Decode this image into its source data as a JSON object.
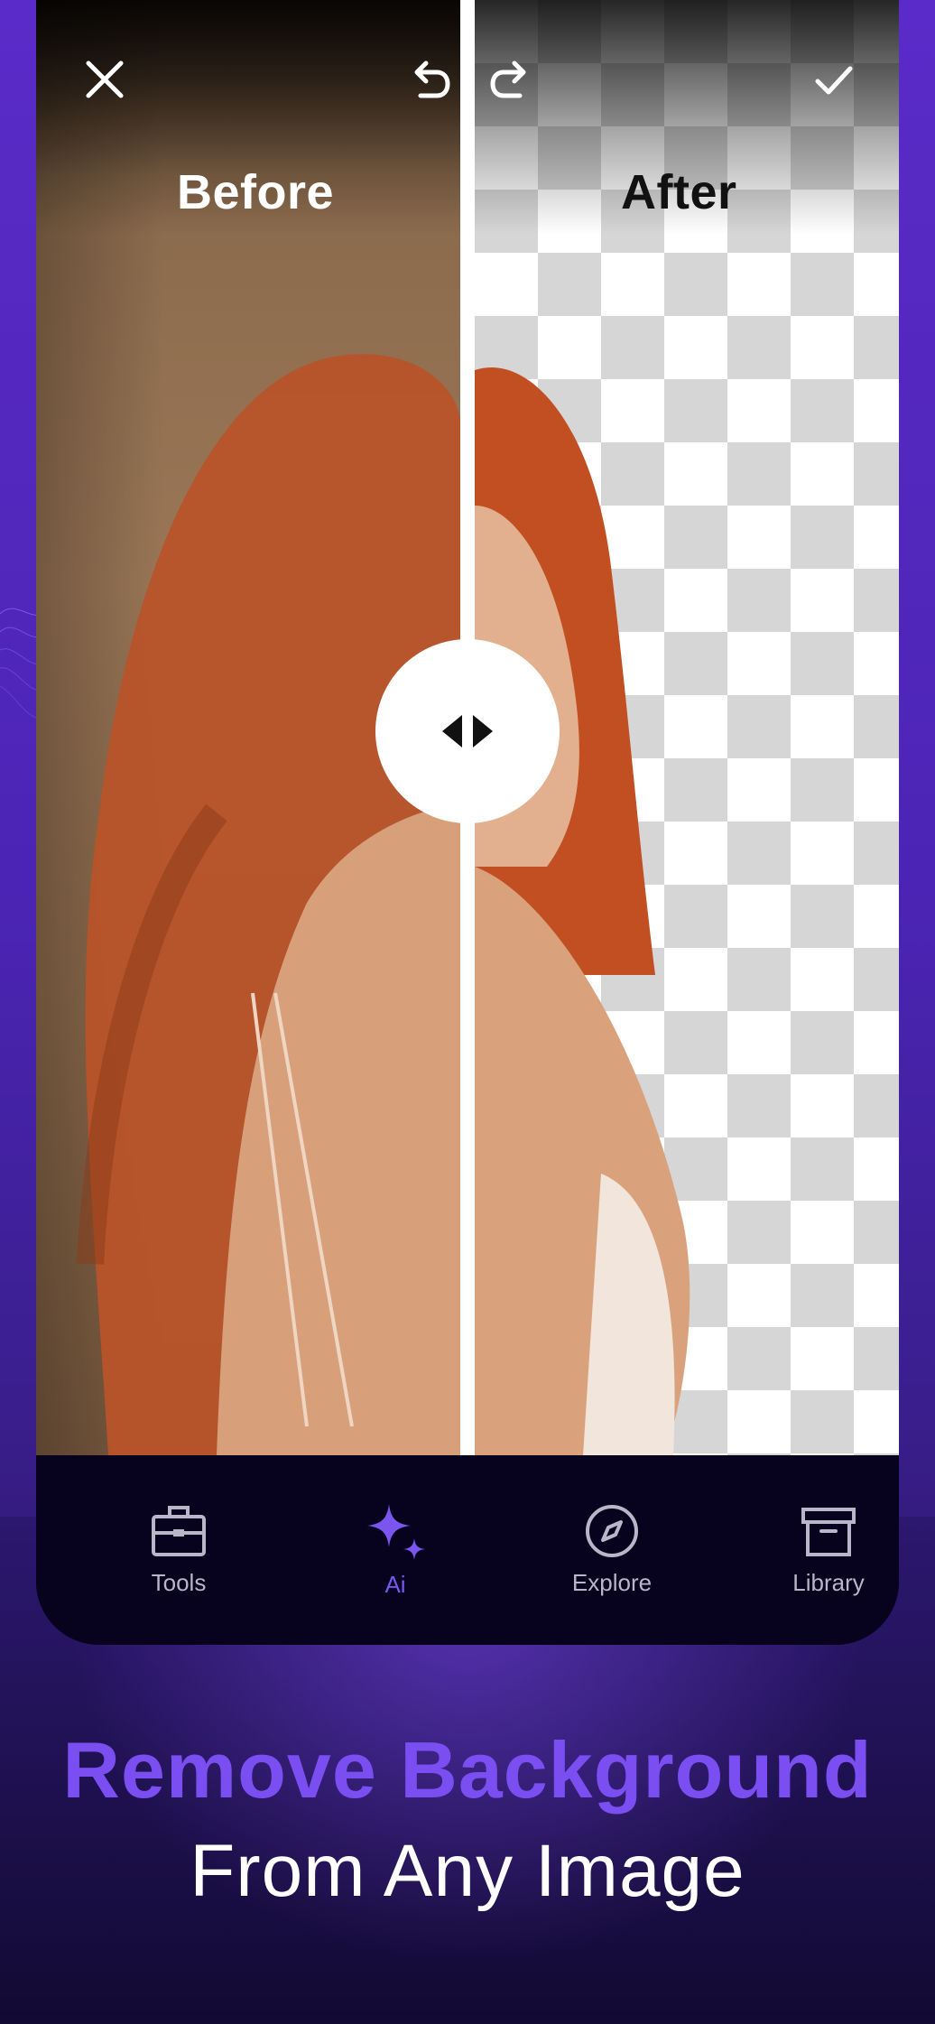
{
  "colors": {
    "accent": "#7b4ef2",
    "tab_active": "#7a55f0",
    "tab_inactive": "#b8b6c8",
    "tabbar_bg": "#07021d",
    "background": "#4b24b4"
  },
  "toolbar": {
    "close_icon": "close-icon",
    "undo_icon": "undo-icon",
    "redo_icon": "redo-icon",
    "confirm_icon": "check-icon"
  },
  "compare": {
    "before_label": "Before",
    "after_label": "After",
    "handle_icon": "compare-arrows-icon"
  },
  "tabs": [
    {
      "label": "Tools",
      "icon": "toolbox-icon",
      "active": false
    },
    {
      "label": "Ai",
      "icon": "sparkle-icon",
      "active": true
    },
    {
      "label": "Explore",
      "icon": "compass-icon",
      "active": false
    },
    {
      "label": "Library",
      "icon": "archive-icon",
      "active": false
    }
  ],
  "promo": {
    "headline": "Remove Background",
    "subline": "From Any Image"
  }
}
